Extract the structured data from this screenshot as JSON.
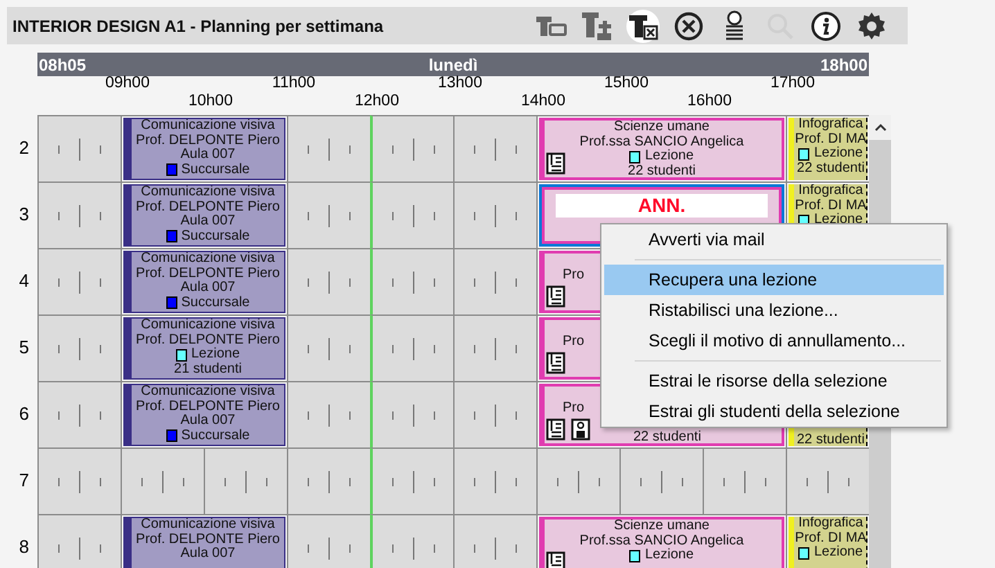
{
  "window": {
    "title": "INTERIOR DESIGN A1 - Planning per settimana"
  },
  "toolbar": [
    {
      "kind": "table-link",
      "disabled": false
    },
    {
      "kind": "table-add",
      "disabled": false
    },
    {
      "kind": "table-remove",
      "disabled": false
    },
    {
      "kind": "cancel",
      "disabled": false
    },
    {
      "kind": "person-list",
      "disabled": false
    },
    {
      "kind": "search",
      "disabled": true
    },
    {
      "kind": "info",
      "disabled": false
    },
    {
      "kind": "settings",
      "disabled": false
    }
  ],
  "timeline": {
    "start": "08h05",
    "day": "lunedì",
    "end": "18h00",
    "hours": [
      "09h00",
      "10h00",
      "11h00",
      "12h00",
      "13h00",
      "14h00",
      "15h00",
      "16h00",
      "17h00"
    ]
  },
  "rows": [
    {
      "label": "2",
      "cells": [
        {
          "kind": "free"
        },
        {
          "kind": "room",
          "subject": "Comunicazione visiva",
          "teacher": "Prof. DELPONTE Piero",
          "room": "Aula 007",
          "tag": {
            "label": "Succursale",
            "color": "#0000ff"
          }
        },
        {
          "kind": "free"
        },
        {
          "kind": "free"
        },
        {
          "kind": "free"
        },
        {
          "kind": "class",
          "subject": "Scienze umane",
          "teacher": "Prof.ssa SANCIO Angelica",
          "tag": {
            "label": "Lezione",
            "color": "#66ffff"
          },
          "students": "22 studenti",
          "icons": [
            {
              "kind": "document"
            }
          ]
        },
        {
          "kind": "elective",
          "subject": "Infografica",
          "teacher": "Prof. DI MA",
          "tag": {
            "label": "Lezione",
            "color": "#66ffff"
          },
          "students": "22 studenti"
        }
      ]
    },
    {
      "label": "3",
      "cells": [
        {
          "kind": "free"
        },
        {
          "kind": "room",
          "subject": "Comunicazione visiva",
          "teacher": "Prof. DELPONTE Piero",
          "room": "Aula 007",
          "tag": {
            "label": "Succursale",
            "color": "#0000ff"
          }
        },
        {
          "kind": "free"
        },
        {
          "kind": "free"
        },
        {
          "kind": "free"
        },
        {
          "kind": "cancelled",
          "banner": "ANN.",
          "selected": true
        },
        {
          "kind": "elective",
          "subject": "Infografica",
          "teacher": "Prof. DI MA",
          "tag": {
            "label": "Lezione",
            "color": "#66ffff"
          }
        }
      ]
    },
    {
      "label": "4",
      "cells": [
        {
          "kind": "free"
        },
        {
          "kind": "room",
          "subject": "Comunicazione visiva",
          "teacher": "Prof. DELPONTE Piero",
          "room": "Aula 007",
          "tag": {
            "label": "Succursale",
            "color": "#0000ff"
          }
        },
        {
          "kind": "free"
        },
        {
          "kind": "free"
        },
        {
          "kind": "free"
        },
        {
          "kind": "class",
          "teacher": "Pro",
          "icons": [
            {
              "kind": "document"
            }
          ],
          "cut": true
        }
      ]
    },
    {
      "label": "5",
      "cells": [
        {
          "kind": "free"
        },
        {
          "kind": "room",
          "subject": "Comunicazione visiva",
          "teacher": "Prof. DELPONTE Piero",
          "tag": {
            "label": "Lezione",
            "color": "#66ffff"
          },
          "students": "21 studenti"
        },
        {
          "kind": "free"
        },
        {
          "kind": "free"
        },
        {
          "kind": "free"
        },
        {
          "kind": "class",
          "teacher": "Pro",
          "icons": [
            {
              "kind": "document"
            }
          ],
          "cut": true
        }
      ]
    },
    {
      "label": "6",
      "cells": [
        {
          "kind": "free"
        },
        {
          "kind": "room",
          "subject": "Comunicazione visiva",
          "teacher": "Prof. DELPONTE Piero",
          "room": "Aula 007",
          "tag": {
            "label": "Succursale",
            "color": "#0000ff"
          }
        },
        {
          "kind": "free"
        },
        {
          "kind": "free"
        },
        {
          "kind": "free"
        },
        {
          "kind": "class",
          "teacher": "Pro",
          "students": "22 studenti",
          "icons": [
            {
              "kind": "document"
            },
            {
              "kind": "person"
            }
          ],
          "cut": true
        },
        {
          "kind": "elective",
          "students": "22 studenti",
          "cut": true
        }
      ]
    },
    {
      "label": "7",
      "cells": [
        {
          "kind": "free"
        },
        {
          "kind": "free"
        },
        {
          "kind": "free"
        },
        {
          "kind": "free"
        },
        {
          "kind": "free"
        },
        {
          "kind": "free"
        },
        {
          "kind": "free"
        },
        {
          "kind": "free"
        },
        {
          "kind": "free"
        },
        {
          "kind": "free"
        }
      ]
    },
    {
      "label": "8",
      "cells": [
        {
          "kind": "free"
        },
        {
          "kind": "room",
          "subject": "Comunicazione visiva",
          "teacher": "Prof. DELPONTE Piero",
          "room": "Aula 007"
        },
        {
          "kind": "free"
        },
        {
          "kind": "free"
        },
        {
          "kind": "free"
        },
        {
          "kind": "class",
          "subject": "Scienze umane",
          "teacher": "Prof.ssa SANCIO Angelica",
          "tag": {
            "label": "Lezione",
            "color": "#66ffff"
          },
          "icons": [
            {
              "kind": "document"
            }
          ]
        },
        {
          "kind": "elective",
          "subject": "Infografica",
          "teacher": "Prof. DI MA",
          "tag": {
            "label": "Lezione",
            "color": "#66ffff"
          }
        }
      ]
    }
  ],
  "context_menu": {
    "groups": [
      [
        {
          "label": "Avverti via mail",
          "selected": false
        }
      ],
      [
        {
          "label": "Recupera una lezione",
          "selected": true
        },
        {
          "label": "Ristabilisci una lezione...",
          "selected": false
        },
        {
          "label": "Scegli il motivo di annullamento...",
          "selected": false
        }
      ],
      [
        {
          "label": "Estrai le risorse della selezione",
          "selected": false
        },
        {
          "label": "Estrai gli studenti della selezione",
          "selected": false
        }
      ]
    ]
  }
}
